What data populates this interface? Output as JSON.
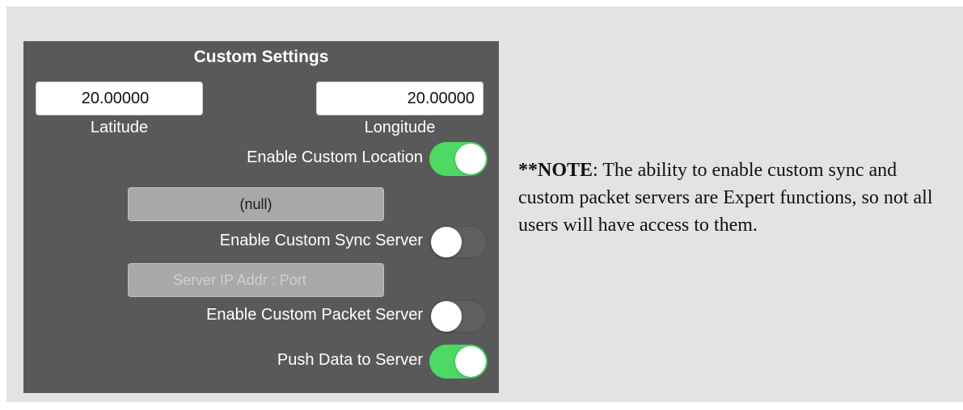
{
  "panel": {
    "title": "Custom Settings",
    "latitude": {
      "value": "20.00000",
      "label": "Latitude"
    },
    "longitude": {
      "value": "20.00000",
      "label": "Longitude"
    },
    "custom_location": {
      "label": "Enable Custom Location",
      "enabled": true
    },
    "sync_server_field": {
      "value": "(null)"
    },
    "custom_sync": {
      "label": "Enable Custom Sync Server",
      "enabled": false
    },
    "packet_server_field": {
      "placeholder": "Server IP Addr : Port"
    },
    "custom_packet": {
      "label": "Enable Custom Packet Server",
      "enabled": false
    },
    "push_data": {
      "label": "Push Data to Server",
      "enabled": true
    }
  },
  "note": {
    "prefix": "**NOTE",
    "text": ": The ability to enable custom sync and custom packet servers are Expert functions, so not all users will have access to them."
  },
  "colors": {
    "panel_bg": "#595959",
    "toggle_on": "#4cd964",
    "page_bg": "#e3e3e3"
  }
}
